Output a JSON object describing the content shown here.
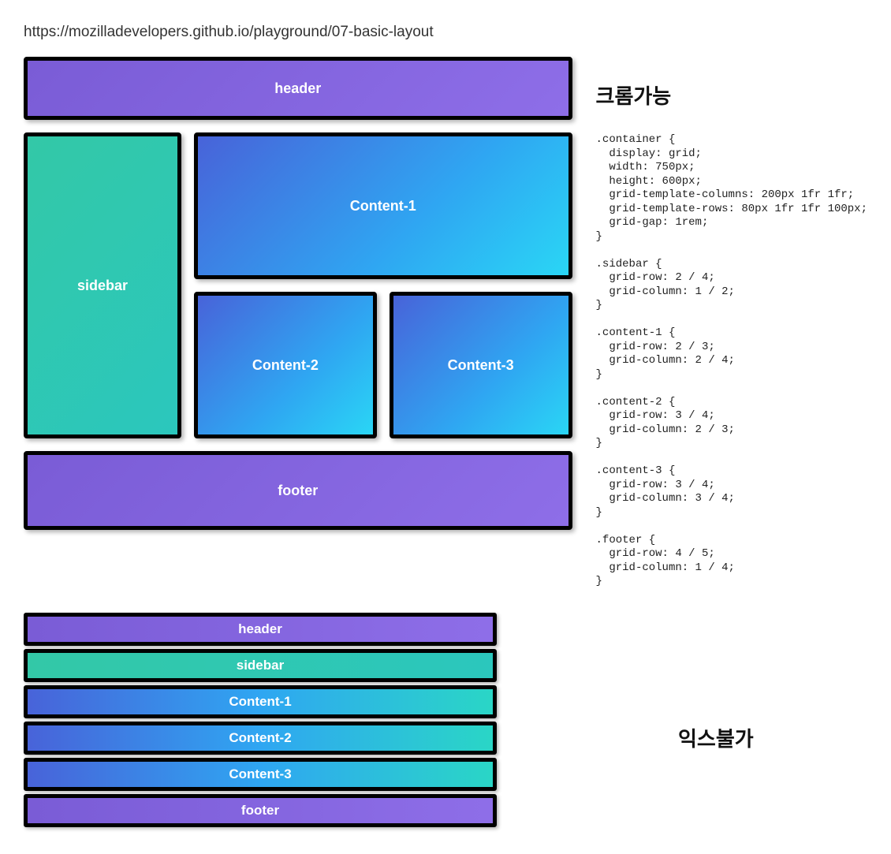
{
  "url": "https://mozilladevelopers.github.io/playground/07-basic-layout",
  "heading_top": "크롬가능",
  "heading_bottom": "익스불가",
  "grid": {
    "header": "header",
    "sidebar": "sidebar",
    "content1": "Content-1",
    "content2": "Content-2",
    "content3": "Content-3",
    "footer": "footer"
  },
  "stacked": {
    "header": "header",
    "sidebar": "sidebar",
    "content1": "Content-1",
    "content2": "Content-2",
    "content3": "Content-3",
    "footer": "footer"
  },
  "css_code": ".container {\n  display: grid;\n  width: 750px;\n  height: 600px;\n  grid-template-columns: 200px 1fr 1fr;\n  grid-template-rows: 80px 1fr 1fr 100px;\n  grid-gap: 1rem;\n}\n\n.sidebar {\n  grid-row: 2 / 4;\n  grid-column: 1 / 2;\n}\n\n.content-1 {\n  grid-row: 2 / 3;\n  grid-column: 2 / 4;\n}\n\n.content-2 {\n  grid-row: 3 / 4;\n  grid-column: 2 / 3;\n}\n\n.content-3 {\n  grid-row: 3 / 4;\n  grid-column: 3 / 4;\n}\n\n.footer {\n  grid-row: 4 / 5;\n  grid-column: 1 / 4;\n}"
}
